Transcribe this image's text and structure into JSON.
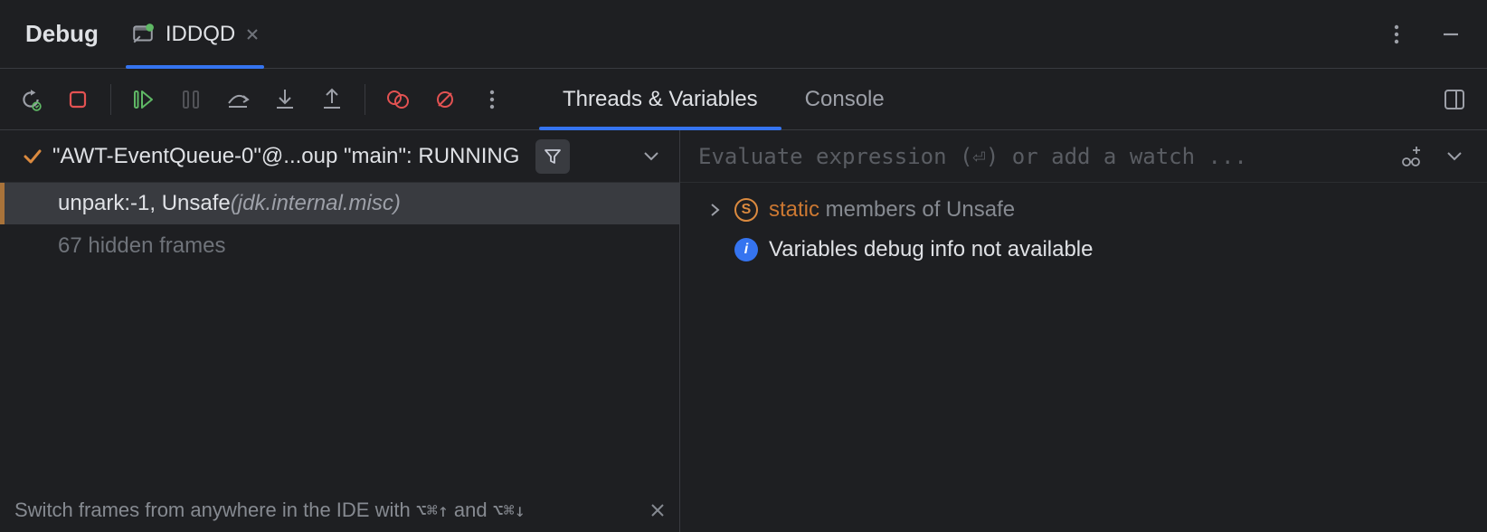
{
  "header": {
    "title": "Debug",
    "run_config": "IDDQD"
  },
  "tabs": {
    "threads": "Threads & Variables",
    "console": "Console"
  },
  "thread": {
    "label": "\"AWT-EventQueue-0\"@...oup \"main\": RUNNING"
  },
  "frames": {
    "selected_name": "unpark:-1, Unsafe ",
    "selected_pkg": "(jdk.internal.misc)",
    "hidden_label": "67 hidden frames"
  },
  "tip": {
    "text": "Switch frames from anywhere in the IDE with ",
    "key1": "⌥⌘↑",
    "mid": " and ",
    "key2": "⌥⌘↓"
  },
  "eval": {
    "placeholder": "Evaluate expression (⏎) or add a watch ..."
  },
  "vars": {
    "static_kw": "static",
    "static_rest": " members of Unsafe",
    "info_msg": "Variables debug info not available"
  }
}
